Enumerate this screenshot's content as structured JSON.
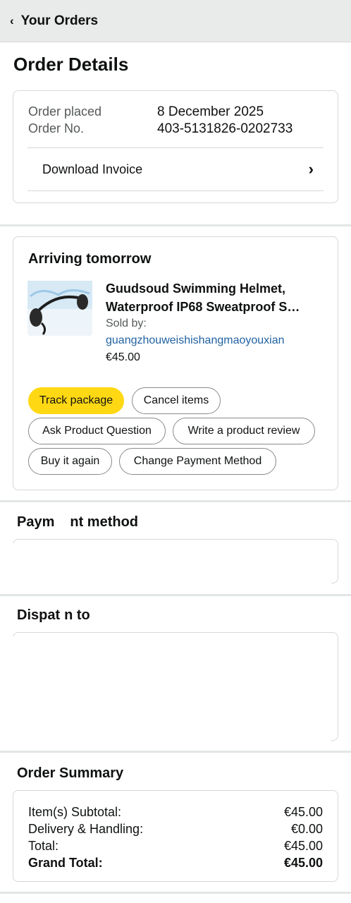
{
  "header": {
    "back_label": "Your Orders"
  },
  "page": {
    "title": "Order Details"
  },
  "order_info": {
    "placed_label": "Order placed",
    "placed_value": "8 December 2025",
    "number_label": "Order No.",
    "number_value": "403-5131826-0202733",
    "invoice_label": "Download Invoice"
  },
  "shipment": {
    "status": "Arriving tomorrow",
    "product_title_line1": "Guudsoud Swimming Helmet,",
    "product_title_line2": "Waterproof IP68 Sweatproof S…",
    "sold_by_label": "Sold by:",
    "seller": "guangzhouweishishangmaoyouxian",
    "price": "€45.00",
    "buttons": {
      "track": "Track package",
      "cancel": "Cancel items",
      "ask": "Ask Product Question",
      "review": "Write a product review",
      "buy_again": "Buy it again",
      "change_payment": "Change Payment Method"
    }
  },
  "payment": {
    "heading": "Paym",
    "heading_tail": "nt method"
  },
  "dispatch": {
    "heading_a": "Dispat",
    "heading_b": "n to"
  },
  "summary": {
    "heading": "Order Summary",
    "rows": [
      {
        "label": "Item(s) Subtotal:",
        "value": "€45.00"
      },
      {
        "label": "Delivery & Handling:",
        "value": "€0.00"
      },
      {
        "label": "Total:",
        "value": "€45.00"
      }
    ],
    "grand_label": "Grand Total:",
    "grand_value": "€45.00"
  },
  "colors": {
    "primary_button": "#ffd814",
    "link": "#2162a1"
  },
  "icons": {
    "back": "chevron-left-icon",
    "invoice": "chevron-right-icon"
  }
}
